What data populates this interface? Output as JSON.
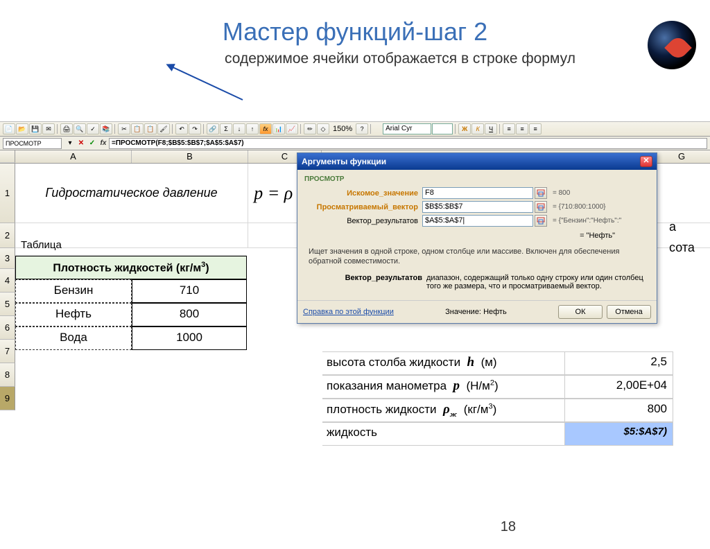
{
  "page": {
    "number": "18"
  },
  "title": "Мастер функций-шаг 2",
  "subtitle": "содержимое ячейки отображается в строке формул",
  "toolbar": {
    "zoom": "150%",
    "font": "Arial Cyr",
    "size": ""
  },
  "formulabar": {
    "name": "ПРОСМОТР",
    "formula": "=ПРОСМОТР(F8;$B$5:$B$7;$A$5:$A$7)"
  },
  "columns": [
    "A",
    "B",
    "C",
    "G"
  ],
  "sheet": {
    "hydro": "Гидростатическое давление",
    "eqn": "p = ρ · g",
    "table_label": "Таблица",
    "density_header": "Плотность жидкостей (кг/м",
    "rows": [
      {
        "name": "Бензин",
        "val": "710"
      },
      {
        "name": "Нефть",
        "val": "800"
      },
      {
        "name": "Вода",
        "val": "1000"
      }
    ],
    "right_txt_a": "а",
    "right_txt_sota": "сота",
    "right": [
      {
        "label": "высота столба жидкости",
        "sym": "h",
        "unit": "(м)",
        "val": "2,5"
      },
      {
        "label": "показания манометра",
        "sym": "p",
        "unit": "(Н/м",
        "sup": "2",
        "val": "2,00E+04"
      },
      {
        "label": "плотность жидкости",
        "sym": "ρ",
        "sub": "ж",
        "unit": "(кг/м",
        "sup": "3",
        "val": "800"
      },
      {
        "label": "жидкость",
        "val": "$5:$A$7)"
      }
    ]
  },
  "dialog": {
    "title": "Аргументы функции",
    "fn": "ПРОСМОТР",
    "args": [
      {
        "label": "Искомое_значение",
        "bold": true,
        "value": "F8",
        "result": "= 800"
      },
      {
        "label": "Просматриваемый_вектор",
        "bold": true,
        "value": "$B$5:$B$7",
        "result": "= {710:800:1000}"
      },
      {
        "label": "Вектор_результатов",
        "bold": false,
        "value": "$A$5:$A$7|",
        "result": "= {\"Бензин\":\"Нефть\":\""
      }
    ],
    "equals": "= \"Нефть\"",
    "desc": "Ищет значения в одной строке, одном столбце или массиве. Включен для обеспечения обратной совместимости.",
    "argname": "Вектор_результатов",
    "argdesc": "диапазон, содержащий только одну строку или один столбец того же размера, что и просматриваемый вектор.",
    "help": "Справка по этой функции",
    "value_label": "Значение:",
    "value": "Нефть",
    "ok": "ОК",
    "cancel": "Отмена"
  }
}
